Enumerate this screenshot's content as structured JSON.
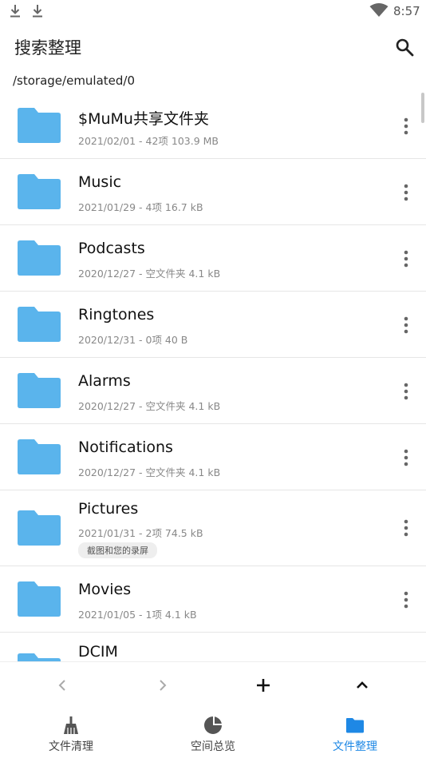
{
  "status": {
    "time": "8:57"
  },
  "header": {
    "title": "搜索整理"
  },
  "path": "/storage/emulated/0",
  "files": [
    {
      "name": "$MuMu共享文件夹",
      "meta": "2021/02/01 - 42项 103.9 MB"
    },
    {
      "name": "Music",
      "meta": "2021/01/29 - 4项 16.7 kB"
    },
    {
      "name": "Podcasts",
      "meta": "2020/12/27 - 空文件夹 4.1 kB"
    },
    {
      "name": "Ringtones",
      "meta": "2020/12/31 - 0项 40 B"
    },
    {
      "name": "Alarms",
      "meta": "2020/12/27 - 空文件夹 4.1 kB"
    },
    {
      "name": "Notifications",
      "meta": "2020/12/27 - 空文件夹 4.1 kB"
    },
    {
      "name": "Pictures",
      "meta": "2021/01/31 - 2项 74.5 kB",
      "tag": "截图和您的录屏"
    },
    {
      "name": "Movies",
      "meta": "2021/01/05 - 1项 4.1 kB"
    },
    {
      "name": "DCIM",
      "meta": ""
    }
  ],
  "nav": {
    "items": [
      {
        "label": "文件清理",
        "icon": "broom-icon"
      },
      {
        "label": "空间总览",
        "icon": "pie-chart-icon"
      },
      {
        "label": "文件整理",
        "icon": "folder-icon"
      }
    ]
  },
  "colors": {
    "folder": "#5ab4ec",
    "accent": "#1e88e5"
  }
}
